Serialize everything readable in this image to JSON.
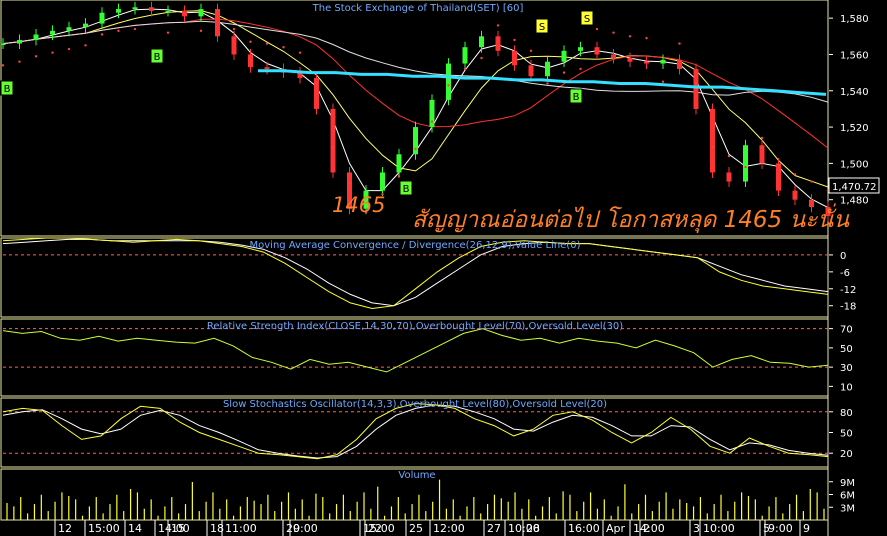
{
  "chart_data": [
    {
      "type": "candlestick",
      "title": "The Stock Exchange of Thailand(SET) [60]",
      "y_ticks": [
        "1,580",
        "1,560",
        "1,540",
        "1,520",
        "1,500",
        "1,480"
      ],
      "ylim": [
        1460,
        1590
      ],
      "last_price_label": "1,470.72",
      "annotations": {
        "low_label": "1465",
        "note": "สัญญาณอ่อนต่อไป โอกาสหลุด 1465 นะนั่น"
      },
      "signals": [
        "B",
        "B",
        "B",
        "S",
        "S",
        "B"
      ],
      "series": [
        {
          "name": "Price",
          "values": [
            1566,
            1568,
            1571,
            1573,
            1575,
            1577,
            1583,
            1585,
            1586,
            1584,
            1584,
            1581,
            1585,
            1570,
            1560,
            1553,
            1552,
            1550,
            1547,
            1530,
            1495,
            1475,
            1485,
            1495,
            1505,
            1520,
            1535,
            1555,
            1564,
            1570,
            1562,
            1554,
            1548,
            1556,
            1562,
            1564,
            1560,
            1558,
            1556,
            1555,
            1557,
            1552,
            1530,
            1495,
            1490,
            1510,
            1500,
            1485,
            1480,
            1476,
            1471
          ]
        },
        {
          "name": "Support",
          "values": [
            1551,
            1551,
            1550,
            1550,
            1549,
            1549,
            1548,
            1548,
            1547,
            1547,
            1546,
            1546,
            1545,
            1545,
            1544,
            1544,
            1543,
            1542,
            1542,
            1541,
            1540,
            1539,
            1538
          ]
        }
      ],
      "volume": {
        "label": "Volume",
        "y_ticks": [
          "9M",
          "6M",
          "3M"
        ]
      }
    },
    {
      "type": "line",
      "title": "Moving Average Convergence / Divergence(26,12,9),Value Line(0)",
      "y_ticks": [
        "0",
        "-6",
        "-12",
        "-18"
      ],
      "ylim": [
        -22,
        6
      ],
      "series": [
        {
          "name": "MACD",
          "values": [
            5,
            5.5,
            6,
            6,
            5.5,
            5,
            4.5,
            5,
            5.5,
            5,
            4,
            3,
            1,
            -3,
            -8,
            -13,
            -17,
            -19,
            -18,
            -12,
            -6,
            -1,
            3,
            4.5,
            5,
            4.5,
            4,
            4,
            3,
            2,
            1,
            0,
            -1,
            -6,
            -9,
            -11,
            -12,
            -13,
            -14
          ]
        },
        {
          "name": "Signal",
          "values": [
            4,
            4.5,
            5,
            5.5,
            5.5,
            5,
            5,
            5,
            5,
            5,
            4.5,
            3.5,
            2,
            -1,
            -5,
            -10,
            -14,
            -17,
            -18,
            -15,
            -10,
            -5,
            0,
            3,
            4,
            4.5,
            4,
            4,
            3,
            2,
            1,
            0,
            -1,
            -4,
            -7,
            -9,
            -11,
            -12,
            -13
          ]
        }
      ]
    },
    {
      "type": "line",
      "title": "Relative Strength Index(CLOSE,14,30,70),Overbought Level(70),Oversold Level(30)",
      "y_ticks": [
        "70",
        "50",
        "30",
        "10"
      ],
      "ylim": [
        0,
        80
      ],
      "series": [
        {
          "name": "RSI",
          "values": [
            68,
            65,
            67,
            60,
            58,
            62,
            57,
            60,
            58,
            56,
            55,
            60,
            52,
            40,
            35,
            28,
            38,
            33,
            35,
            30,
            25,
            35,
            45,
            55,
            65,
            70,
            63,
            58,
            60,
            55,
            60,
            57,
            55,
            50,
            58,
            52,
            45,
            30,
            38,
            42,
            35,
            34,
            30,
            32
          ]
        }
      ]
    },
    {
      "type": "line",
      "title": "Slow Stochastics Oscillator(14,3,3),Overbought Level(80),Oversold Level(20)",
      "y_ticks": [
        "80",
        "50",
        "20"
      ],
      "ylim": [
        0,
        100
      ],
      "series": [
        {
          "name": "%K",
          "values": [
            80,
            85,
            82,
            60,
            40,
            45,
            70,
            88,
            85,
            65,
            50,
            40,
            30,
            20,
            18,
            15,
            12,
            18,
            40,
            70,
            85,
            92,
            90,
            85,
            70,
            60,
            45,
            55,
            75,
            80,
            68,
            50,
            35,
            50,
            72,
            55,
            30,
            20,
            42,
            30,
            20,
            18,
            15
          ]
        },
        {
          "name": "%D",
          "values": [
            75,
            80,
            83,
            70,
            55,
            48,
            55,
            75,
            82,
            75,
            60,
            50,
            38,
            25,
            20,
            16,
            13,
            15,
            30,
            55,
            75,
            85,
            90,
            88,
            80,
            70,
            55,
            52,
            65,
            75,
            72,
            60,
            45,
            45,
            60,
            58,
            40,
            25,
            35,
            32,
            24,
            20,
            17
          ]
        }
      ]
    },
    {
      "type": "axis",
      "x_ticks": [
        "12",
        "15:00",
        "14",
        "14:00",
        "15",
        "11:00",
        "18",
        "9:00",
        "20",
        "15:00",
        "22",
        "25",
        "12:00",
        "27",
        "10:00",
        "28",
        "16:00",
        "Apr",
        "14:00",
        "2",
        "3",
        "10:00",
        "9:00",
        "5",
        "9"
      ]
    }
  ]
}
